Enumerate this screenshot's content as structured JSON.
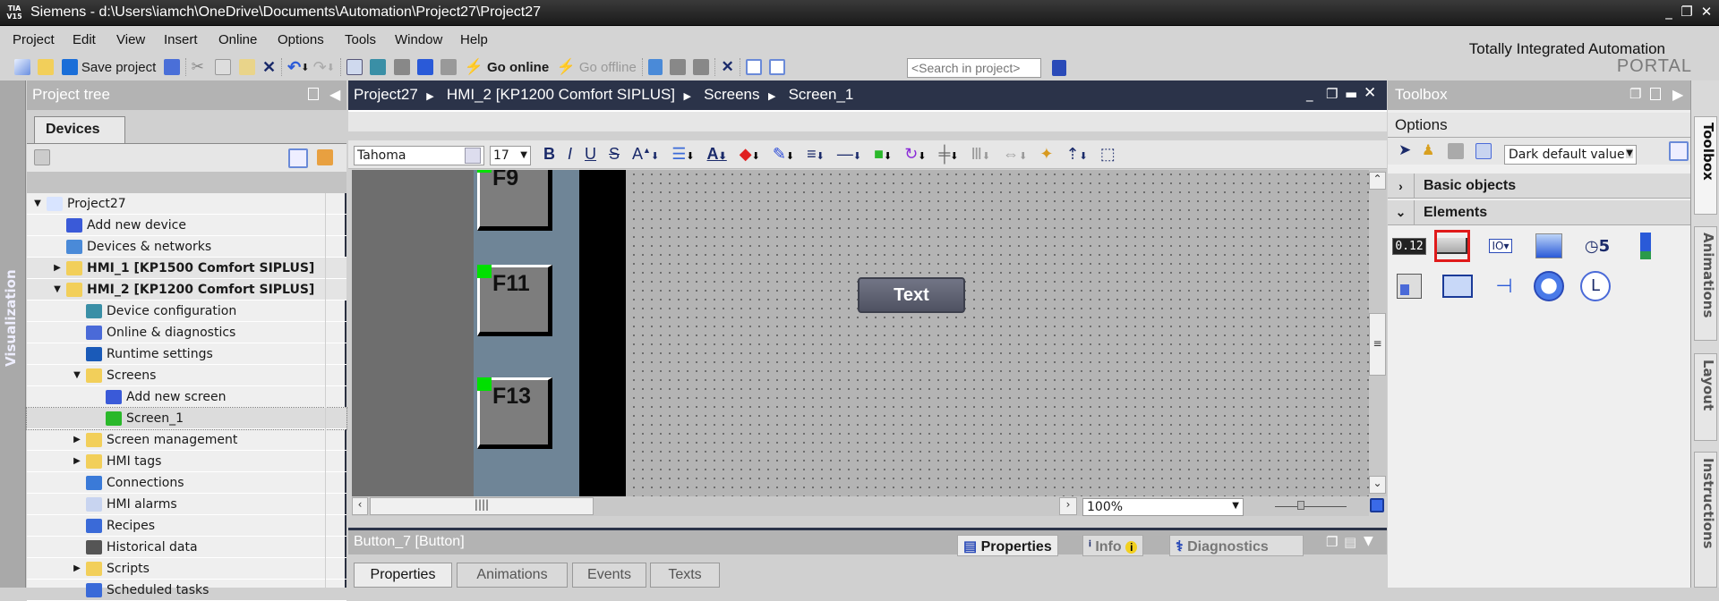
{
  "window": {
    "app_badge_top": "TIA",
    "app_badge_bottom": "V15",
    "title": "Siemens  -  d:\\Users\\iamch\\OneDrive\\Documents\\Automation\\Project27\\Project27",
    "minimize": "_",
    "restore": "❐",
    "close": "✕"
  },
  "menu": [
    "Project",
    "Edit",
    "View",
    "Insert",
    "Online",
    "Options",
    "Tools",
    "Window",
    "Help"
  ],
  "brand": {
    "line1": "Totally Integrated Automation",
    "line2": "PORTAL"
  },
  "toolbar": {
    "save_label": "Save project",
    "go_online": "Go online",
    "go_offline": "Go offline",
    "search_placeholder": "<Search in project>"
  },
  "left_strip": {
    "label": "Visualization"
  },
  "project_tree": {
    "title": "Project tree",
    "tab": "Devices",
    "items": [
      {
        "label": "Project27",
        "level": 0,
        "expander": "▼",
        "bold": false
      },
      {
        "label": "Add new device",
        "level": 1,
        "expander": "",
        "bold": false
      },
      {
        "label": "Devices & networks",
        "level": 1,
        "expander": "",
        "bold": false
      },
      {
        "label": "HMI_1 [KP1500 Comfort SIPLUS]",
        "level": 1,
        "expander": "▶",
        "bold": true
      },
      {
        "label": "HMI_2 [KP1200 Comfort SIPLUS]",
        "level": 1,
        "expander": "▼",
        "bold": true
      },
      {
        "label": "Device configuration",
        "level": 2,
        "expander": "",
        "bold": false
      },
      {
        "label": "Online & diagnostics",
        "level": 2,
        "expander": "",
        "bold": false
      },
      {
        "label": "Runtime settings",
        "level": 2,
        "expander": "",
        "bold": false
      },
      {
        "label": "Screens",
        "level": 2,
        "expander": "▼",
        "bold": false
      },
      {
        "label": "Add new screen",
        "level": 3,
        "expander": "",
        "bold": false
      },
      {
        "label": "Screen_1",
        "level": 3,
        "expander": "",
        "bold": false,
        "selected": true
      },
      {
        "label": "Screen management",
        "level": 2,
        "expander": "▶",
        "bold": false
      },
      {
        "label": "HMI tags",
        "level": 2,
        "expander": "▶",
        "bold": false
      },
      {
        "label": "Connections",
        "level": 2,
        "expander": "",
        "bold": false
      },
      {
        "label": "HMI alarms",
        "level": 2,
        "expander": "",
        "bold": false
      },
      {
        "label": "Recipes",
        "level": 2,
        "expander": "",
        "bold": false
      },
      {
        "label": "Historical data",
        "level": 2,
        "expander": "",
        "bold": false
      },
      {
        "label": "Scripts",
        "level": 2,
        "expander": "▶",
        "bold": false
      },
      {
        "label": "Scheduled tasks",
        "level": 2,
        "expander": "",
        "bold": false
      }
    ]
  },
  "editor": {
    "breadcrumb": [
      "Project27",
      "HMI_2 [KP1200 Comfort SIPLUS]",
      "Screens",
      "Screen_1"
    ],
    "font_name": "Tahoma",
    "font_size": "17",
    "format_bold": "B",
    "format_italic": "I",
    "format_underline": "U",
    "format_strike": "S",
    "function_keys": [
      "F9",
      "F11",
      "F13"
    ],
    "text_button_label": "Text",
    "zoom": "100%",
    "colors": {
      "device_frame": "#6e6e6e",
      "key_panel": "#6f8597",
      "key_led": "#00e000"
    }
  },
  "inspector": {
    "title": "Button_7 [Button]",
    "tabs": [
      "Properties",
      "Animations",
      "Events",
      "Texts"
    ],
    "right_tabs": [
      "Properties",
      "Info",
      "Diagnostics"
    ],
    "info_badge": "i"
  },
  "toolbox": {
    "title": "Toolbox",
    "options_label": "Options",
    "style_value": "Dark default value",
    "sections": [
      {
        "label": "Basic objects",
        "expanded": false
      },
      {
        "label": "Elements",
        "expanded": true
      }
    ],
    "elements": [
      "I/O field",
      "Button",
      "Symbolic I/O field",
      "Graphic I/O field",
      "Date/time field",
      "Bar",
      "Switch",
      "Symbol library",
      "Slider",
      "Gauge",
      "Clock"
    ],
    "selected_element": "Button"
  },
  "right_strip": [
    "Toolbox",
    "Animations",
    "Layout",
    "Instructions"
  ]
}
